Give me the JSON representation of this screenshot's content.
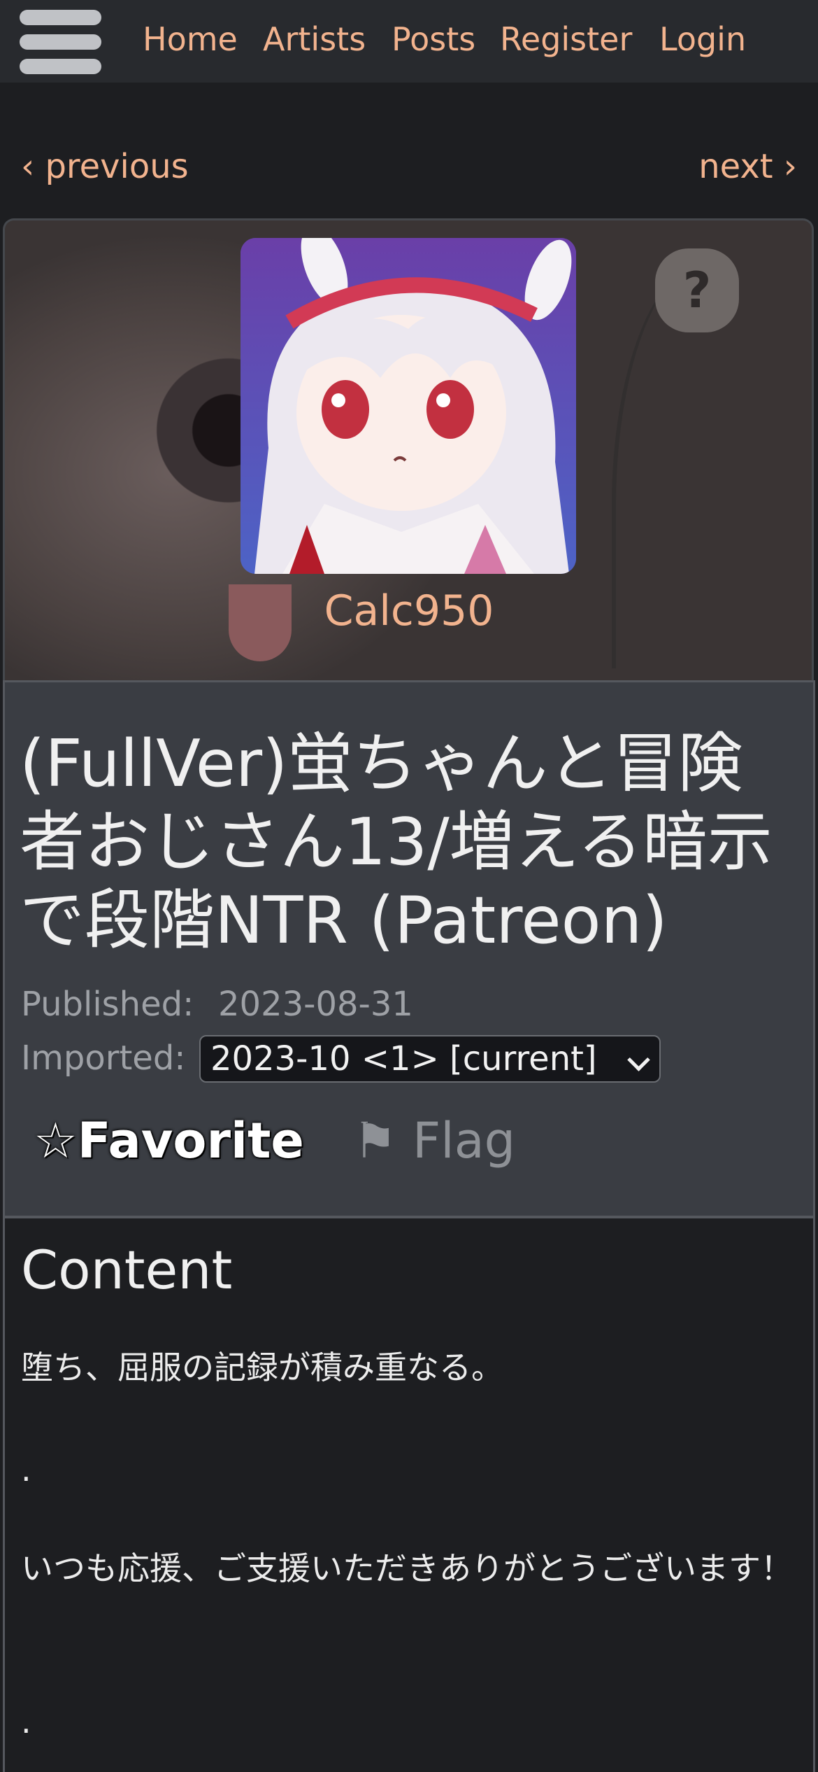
{
  "nav": {
    "links": [
      "Home",
      "Artists",
      "Posts",
      "Register",
      "Login"
    ]
  },
  "pager": {
    "previous": "‹ previous",
    "next": "next ›"
  },
  "artist": {
    "name": "Calc950"
  },
  "banner": {
    "bubble_text": "?"
  },
  "post": {
    "title": "(FullVer)蛍ちゃんと冒険者おじさん13/増える暗示で段階NTR (Patreon)",
    "published_label": "Published:",
    "published_value": "2023-08-31",
    "imported_label": "Imported:",
    "revision_selected": "2023-10 <1> [current]"
  },
  "actions": {
    "favorite_star": "☆",
    "favorite_label": "Favorite",
    "flag_icon": "⚑",
    "flag_label": "Flag"
  },
  "content": {
    "heading": "Content",
    "lines": [
      "堕ち、屈服の記録が積み重なる。",
      ".",
      "いつも応援、ご支援いただきありがとうございます！",
      "."
    ]
  },
  "colors": {
    "accent": "#f2b38e",
    "background": "#1d1e21",
    "nav_bg": "#282a2e",
    "card_bg": "#3a3d43"
  }
}
